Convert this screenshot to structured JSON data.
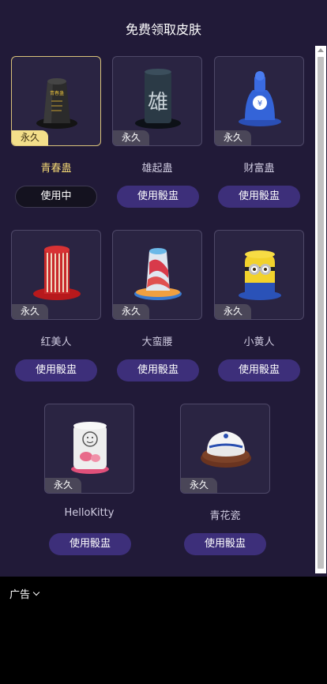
{
  "header": {
    "title": "免费领取皮肤"
  },
  "skins": [
    {
      "name": "青春蛊",
      "badge": "永久",
      "button": "使用中",
      "icon": "black-cup-icon",
      "state": "using"
    },
    {
      "name": "雄起蛊",
      "badge": "永久",
      "button": "使用骰盅",
      "icon": "calligraphy-cup-icon"
    },
    {
      "name": "财富蛊",
      "badge": "永久",
      "button": "使用骰盅",
      "icon": "blue-porcelain-cup-icon"
    },
    {
      "name": "红美人",
      "badge": "永久",
      "button": "使用骰盅",
      "icon": "red-striped-cup-icon"
    },
    {
      "name": "大蛮腰",
      "badge": "永久",
      "button": "使用骰盅",
      "icon": "colorful-cup-icon"
    },
    {
      "name": "小黄人",
      "badge": "永久",
      "button": "使用骰盅",
      "icon": "minion-cup-icon"
    },
    {
      "name": "HelloKitty",
      "badge": "永久",
      "button": "使用骰盅",
      "icon": "hellokitty-cup-icon"
    },
    {
      "name": "青花瓷",
      "badge": "永久",
      "button": "使用骰盅",
      "icon": "blue-white-porcelain-cup-icon"
    }
  ],
  "ad": {
    "label": "广告"
  },
  "colors": {
    "panel": "#211a38",
    "button": "#3d2f7a",
    "active_name": "#f2d774",
    "active_border": "#d9c27a"
  }
}
